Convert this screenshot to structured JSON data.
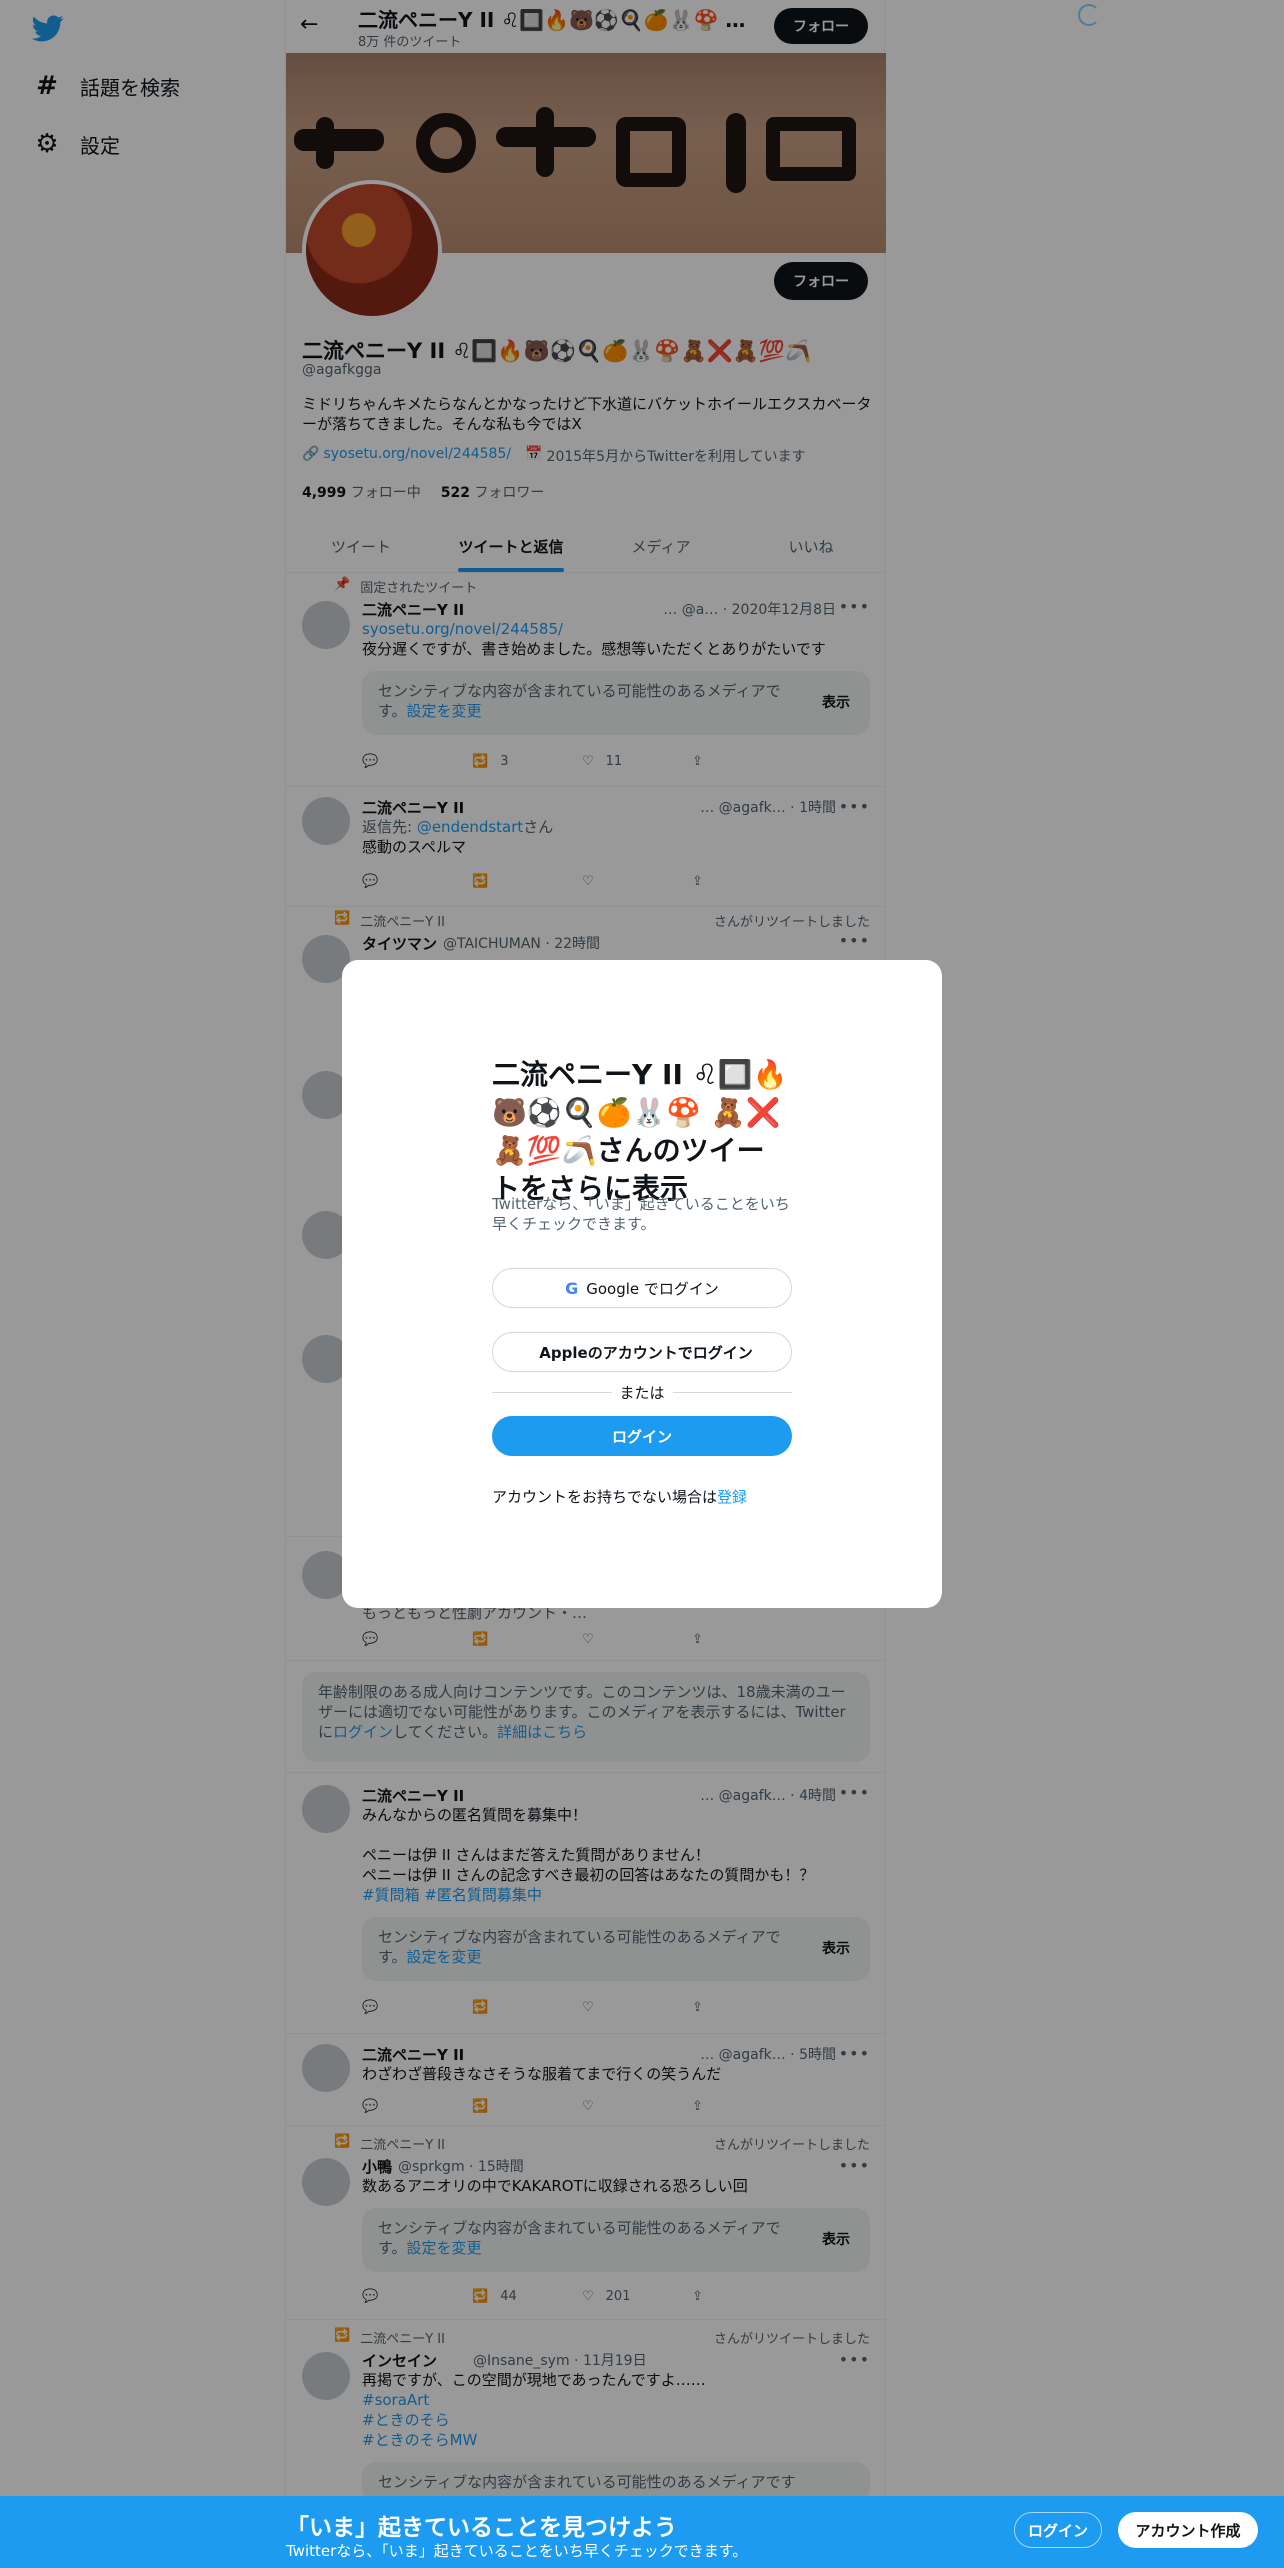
{
  "nav": {
    "items": [
      {
        "icon": "hashtag-icon",
        "glyph": "#",
        "label": "話題を検索"
      },
      {
        "icon": "gear-icon",
        "glyph": "⚙",
        "label": "設定"
      }
    ]
  },
  "header": {
    "name": "二流ペニーY II ♌🔲🔥🐻⚽🍳🍊🐰🍄 …",
    "tweet_count": "8万 件のツイート",
    "follow_label": "フォロー"
  },
  "profile": {
    "name": "二流ペニーY II ♌🔲🔥🐻⚽🍳🍊🐰🍄🧸❌🧸💯🪃",
    "handle": "@agafkgga",
    "bio": "ミドリちゃんキメたらなんとかなったけど下水道にバケットホイールエクスカベーターが落ちてきました。そんな私も今ではX",
    "link": "syosetu.org/novel/244585/",
    "joined": "2015年5月からTwitterを利用しています",
    "following_count": "4,999",
    "following_label": "フォロー中",
    "followers_count": "522",
    "followers_label": "フォロワー",
    "follow_label": "フォロー"
  },
  "tabs": [
    "ツイート",
    "ツイートと返信",
    "メディア",
    "いいね"
  ],
  "tweets": [
    {
      "context": "固定されたツイート",
      "name": "二流ペニーY II",
      "meta": "… @a… · 2020年12月8日",
      "link": "syosetu.org/novel/244585/",
      "text": "夜分遅くですが、書き始めました。感想等いただくとありがたいです",
      "sensitive": "センシティブな内容が含まれている可能性のあるメディアです。",
      "sensitive_link": "設定を変更",
      "show": "表示",
      "retweets": "3",
      "likes": "11"
    },
    {
      "name": "二流ペニーY II",
      "meta": "… @agafk… · 1時間",
      "reply_prefix": "返信先: ",
      "reply_to": "@endendstart",
      "reply_suffix": "さん",
      "text": "感動のスペルマ"
    },
    {
      "context": "二流ペニーY II",
      "context_right": "さんがリツイートしました",
      "name": "タイツマン",
      "meta": "@TAICHUMAN · 22時間"
    },
    {
      "name": "二流ペニーY II",
      "meta": "… @agafk… · 4時間",
      "text": "みんなからの匿名質問を募集中！",
      "text2": "ペニーは伊 II さんはまだ答えた質問がありません！",
      "text3": "ペニーは伊 II さんの記念すべき最初の回答はあなたの質問かも！？",
      "tags": "#質問箱 #匿名質問募集中",
      "sensitive": "センシティブな内容が含まれている可能性のあるメディアです。",
      "sensitive_link": "設定を変更",
      "show": "表示"
    },
    {
      "name": "二流ペニーY II",
      "meta": "… @agafk… · 5時間",
      "text": "わざわざ普段きなさそうな服着てまで行くの笑うんだ"
    },
    {
      "context": "二流ペニーY II",
      "context_right": "さんがリツイートしました",
      "name": "小鴨",
      "meta": "@sprkgm · 15時間",
      "text": "数あるアニオリの中でKAKAROTに収録される恐ろしい回",
      "sensitive": "センシティブな内容が含まれている可能性のあるメディアです。",
      "sensitive_link": "設定を変更",
      "show": "表示",
      "retweets": "44",
      "likes": "201"
    },
    {
      "context": "二流ペニーY II",
      "context_right": "さんがリツイートしました",
      "name": "インセイン",
      "meta": "@Insane_sym · 11月19日",
      "text": "再掲ですが、この空間が現地であったんですよ……",
      "tags": [
        "#soraArt",
        "#ときのそら",
        "#ときのそらMW"
      ],
      "sensitive": "センシティブな内容が含まれている可能性のあるメディアです"
    }
  ],
  "partial_tweet_text": "もっともっと性劇アカウント・…",
  "age_warning": {
    "text": "年齢制限のある成人向けコンテンツです。このコンテンツは、18歳未満のユーザーには適切でない可能性があります。このメディアを表示するには、Twitterに",
    "login_link": "ログイン",
    "after": "してください。",
    "details": "詳細はこちら"
  },
  "modal": {
    "title": "二流ペニーY II ♌🔲🔥🐻⚽🍳🍊🐰🍄 🧸❌🧸💯🪃さんのツイートをさらに表示",
    "subtitle": "Twitterなら、「いま」起きていることをいち早くチェックできます。",
    "google_label": "Google でログイン",
    "apple_label": "Appleのアカウントでログイン",
    "or_label": "または",
    "login_label": "ログイン",
    "signup_prompt": "アカウントをお持ちでない場合は",
    "signup_link": "登録"
  },
  "bottom_bar": {
    "title": "「いま」起きていることを見つけよう",
    "subtitle": "Twitterなら、「いま」起きていることをいち早くチェックできます。",
    "login_label": "ログイン",
    "signup_label": "アカウント作成"
  },
  "colors": {
    "accent": "#1d9bf0",
    "text": "#0f1419",
    "muted": "#536471"
  }
}
